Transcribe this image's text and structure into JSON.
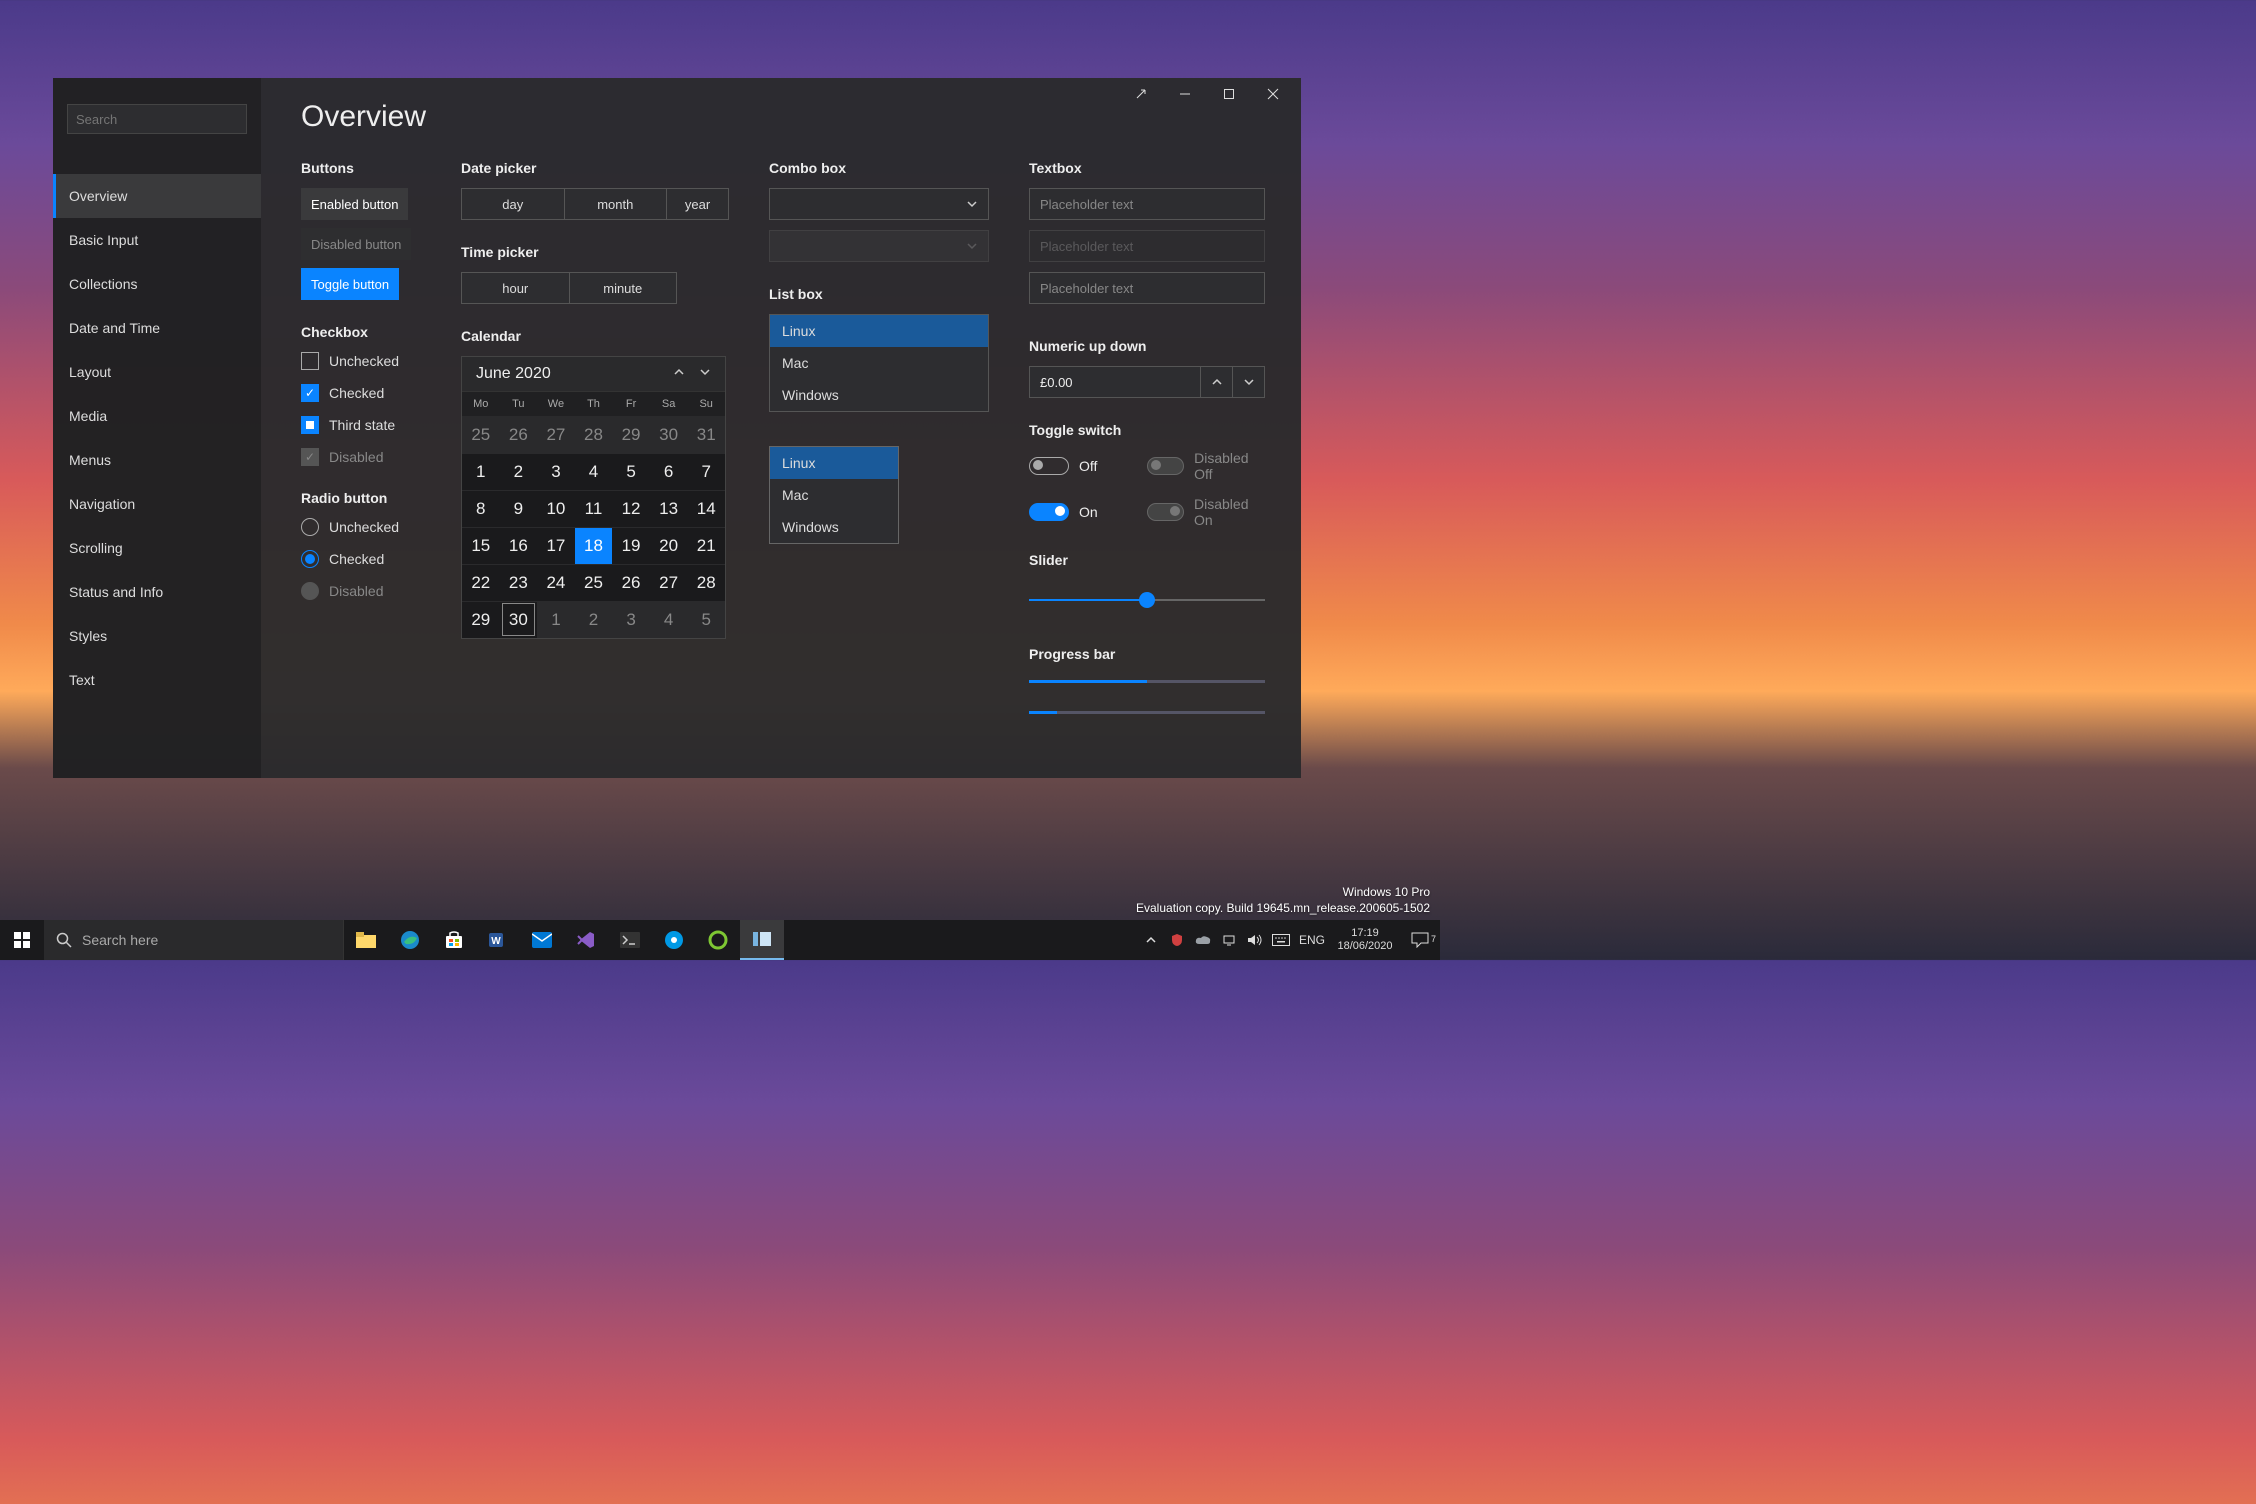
{
  "window": {
    "search_placeholder": "Search",
    "page_title": "Overview",
    "nav": [
      "Overview",
      "Basic Input",
      "Collections",
      "Date and Time",
      "Layout",
      "Media",
      "Menus",
      "Navigation",
      "Scrolling",
      "Status and Info",
      "Styles",
      "Text"
    ],
    "nav_selected": 0
  },
  "sections": {
    "buttons": {
      "label": "Buttons",
      "enabled": "Enabled button",
      "disabled": "Disabled button",
      "toggle": "Toggle button"
    },
    "checkbox": {
      "label": "Checkbox",
      "unchecked": "Unchecked",
      "checked": "Checked",
      "third": "Third state",
      "disabled": "Disabled"
    },
    "radio": {
      "label": "Radio button",
      "unchecked": "Unchecked",
      "checked": "Checked",
      "disabled": "Disabled"
    },
    "datepicker": {
      "label": "Date picker",
      "day": "day",
      "month": "month",
      "year": "year"
    },
    "timepicker": {
      "label": "Time picker",
      "hour": "hour",
      "minute": "minute"
    },
    "calendar": {
      "label": "Calendar",
      "title": "June 2020",
      "dow": [
        "Mo",
        "Tu",
        "We",
        "Th",
        "Fr",
        "Sa",
        "Su"
      ],
      "days": [
        {
          "n": "25",
          "t": "prev"
        },
        {
          "n": "26",
          "t": "prev"
        },
        {
          "n": "27",
          "t": "prev"
        },
        {
          "n": "28",
          "t": "prev"
        },
        {
          "n": "29",
          "t": "prev"
        },
        {
          "n": "30",
          "t": "prev"
        },
        {
          "n": "31",
          "t": "prev"
        },
        {
          "n": "1"
        },
        {
          "n": "2"
        },
        {
          "n": "3"
        },
        {
          "n": "4"
        },
        {
          "n": "5"
        },
        {
          "n": "6"
        },
        {
          "n": "7"
        },
        {
          "n": "8"
        },
        {
          "n": "9"
        },
        {
          "n": "10"
        },
        {
          "n": "11"
        },
        {
          "n": "12"
        },
        {
          "n": "13"
        },
        {
          "n": "14"
        },
        {
          "n": "15"
        },
        {
          "n": "16"
        },
        {
          "n": "17"
        },
        {
          "n": "18",
          "t": "selected"
        },
        {
          "n": "19"
        },
        {
          "n": "20"
        },
        {
          "n": "21"
        },
        {
          "n": "22"
        },
        {
          "n": "23"
        },
        {
          "n": "24"
        },
        {
          "n": "25"
        },
        {
          "n": "26"
        },
        {
          "n": "27"
        },
        {
          "n": "28"
        },
        {
          "n": "29"
        },
        {
          "n": "30",
          "t": "today"
        },
        {
          "n": "1",
          "t": "next"
        },
        {
          "n": "2",
          "t": "next"
        },
        {
          "n": "3",
          "t": "next"
        },
        {
          "n": "4",
          "t": "next"
        },
        {
          "n": "5",
          "t": "next"
        }
      ]
    },
    "combo": {
      "label": "Combo box"
    },
    "listbox": {
      "label": "List box",
      "items": [
        "Linux",
        "Mac",
        "Windows"
      ],
      "selected": 0
    },
    "textbox": {
      "label": "Textbox",
      "placeholder": "Placeholder text"
    },
    "numeric": {
      "label": "Numeric up down",
      "value": "£0.00"
    },
    "toggle": {
      "label": "Toggle switch",
      "off": "Off",
      "on": "On",
      "doff": "Disabled Off",
      "don": "Disabled On"
    },
    "slider": {
      "label": "Slider",
      "value": 50
    },
    "progress": {
      "label": "Progress bar",
      "p1": 50,
      "p2": 12
    }
  },
  "taskbar": {
    "search_placeholder": "Search here",
    "lang": "ENG",
    "time": "17:19",
    "date": "18/06/2020",
    "notif_count": "7"
  },
  "watermark": {
    "line1": "Windows 10 Pro",
    "line2": "Evaluation copy. Build 19645.mn_release.200605-1502"
  }
}
